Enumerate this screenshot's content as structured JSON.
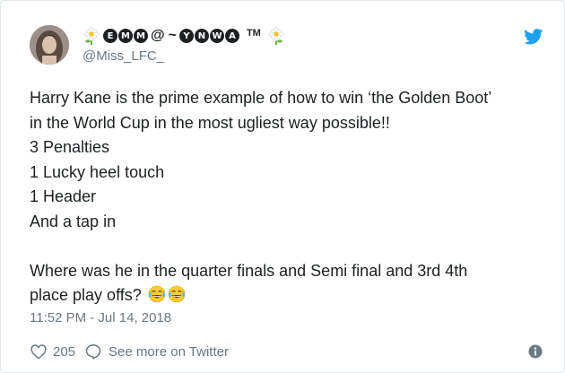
{
  "tweet": {
    "display_name": {
      "letters_a": [
        "E",
        "M",
        "M"
      ],
      "at_sign": "@",
      "tilde": "~",
      "letters_b": [
        "Y",
        "N",
        "W",
        "A"
      ],
      "trademark": "TM"
    },
    "handle": "@Miss_LFC_",
    "lines": [
      "Harry Kane is the prime example of how to win ‘the Golden Boot’",
      "in the World Cup in the most ugliest way possible!!",
      "3 Penalties",
      "1 Lucky heel touch",
      "1 Header",
      "And a tap in",
      "Where was he in the quarter finals and Semi final and 3rd 4th",
      "place  play offs?"
    ],
    "emojis": [
      "face-with-tears-of-joy",
      "face-with-tears-of-joy"
    ],
    "timestamp": "11:52 PM - Jul 14, 2018",
    "like_count": "205",
    "see_more_label": "See more on Twitter",
    "icons": {
      "avatar": "avatar",
      "name_decoration": "daisy-flower-icon",
      "brand": "twitter-bird-icon",
      "like": "heart-icon",
      "reply": "speech-bubble-icon",
      "info": "info-icon"
    },
    "colors": {
      "twitter_blue": "#1da1f2",
      "secondary_text": "#697882",
      "primary_text": "#1c2022"
    }
  }
}
